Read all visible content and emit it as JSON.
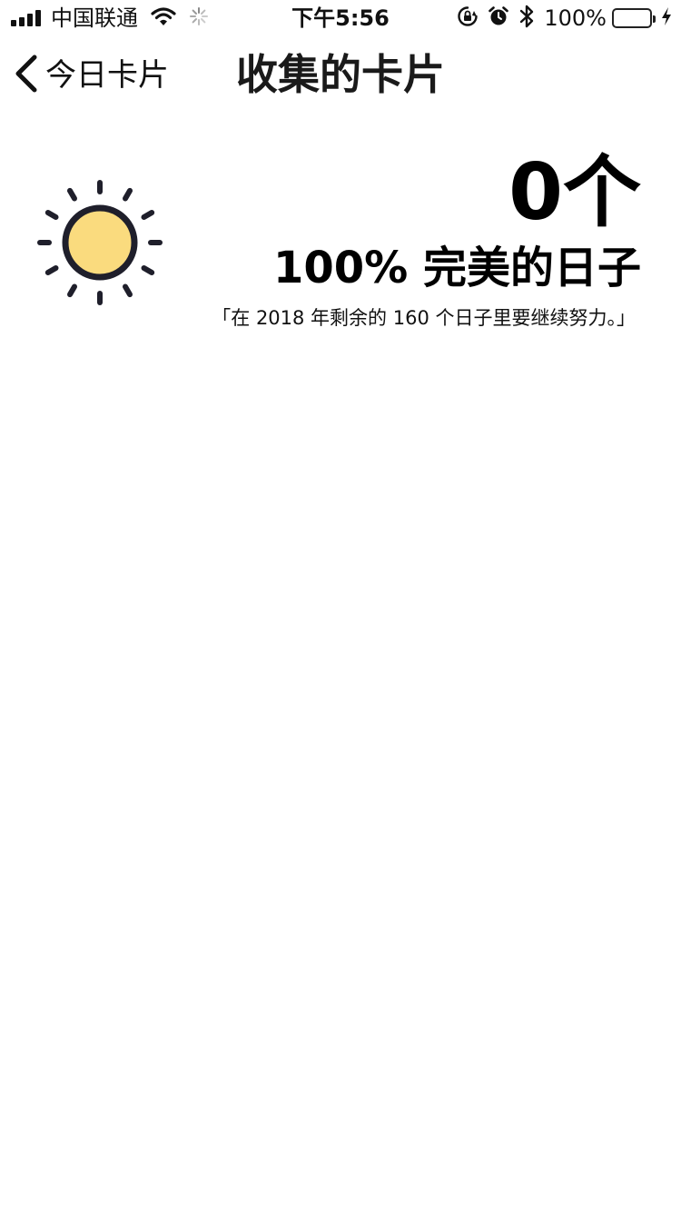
{
  "status_bar": {
    "carrier": "中国联通",
    "time": "下午5:56",
    "battery_percent": "100%",
    "battery_level": 1.0,
    "battery_color": "#6fd86a",
    "icons": [
      "signal-icon",
      "wifi-icon",
      "loading-spinner-icon",
      "rotation-lock-icon",
      "alarm-icon",
      "bluetooth-icon",
      "battery-icon",
      "charging-icon"
    ]
  },
  "nav": {
    "back_label": "今日卡片",
    "back_icon": "chevron-left-icon",
    "title": "收集的卡片"
  },
  "summary": {
    "icon": "sun-icon",
    "sun_fill_color": "#fadb7e",
    "sun_stroke_color": "#1f1f2b",
    "count": "0个",
    "perfect_label": "100% 完美的日子",
    "note": "「在 2018 年剩余的 160 个日子里要继续努力。」"
  }
}
